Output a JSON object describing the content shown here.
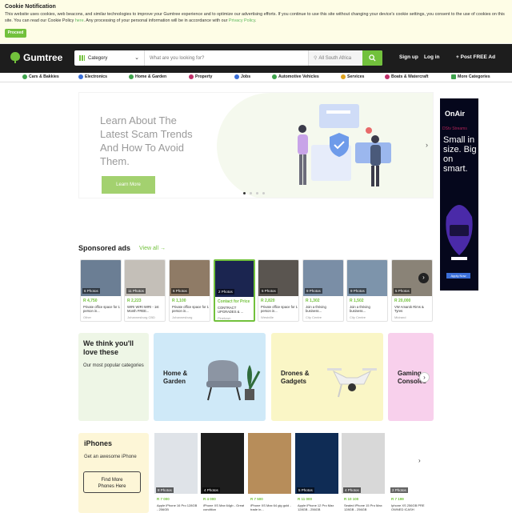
{
  "cookie": {
    "title": "Cookie Notification",
    "text1": "This website uses cookies, web beacons, and similar technologies to improve your Gumtree experience and to optimize our advertising efforts. If you continue to use this site without changing your device's cookie settings, you consent to the use of cookies on this site. You can read our Cookie Policy ",
    "here": "here",
    "text2": ". Any processing of your personal information will be in accordance with our ",
    "privacy": "Privacy Policy",
    "text3": ".",
    "proceed": "Proceed"
  },
  "header": {
    "brand": "Gumtree",
    "category_placeholder": "Category",
    "search_placeholder": "What are you looking for?",
    "location": "All South Africa",
    "signup": "Sign up",
    "login": "Log in",
    "post_ad": "Post FREE Ad"
  },
  "categories": [
    {
      "label": "Cars & Bakkies",
      "color": "#3fa34d"
    },
    {
      "label": "Electronics",
      "color": "#3b6fd8"
    },
    {
      "label": "Home & Garden",
      "color": "#3fa34d"
    },
    {
      "label": "Property",
      "color": "#c0306a"
    },
    {
      "label": "Jobs",
      "color": "#3b6fd8"
    },
    {
      "label": "Automotive Vehicles",
      "color": "#3fa34d"
    },
    {
      "label": "Services",
      "color": "#e0a420"
    },
    {
      "label": "Boats & Watercraft",
      "color": "#c0306a"
    },
    {
      "label": "More Categories",
      "color": "#3fa34d"
    }
  ],
  "hero": {
    "headline": "Learn About The Latest Scam Trends And How To Avoid Them.",
    "cta": "Learn More"
  },
  "side_ad": {
    "brand": "OnAir",
    "tag": "DStv Streams",
    "text": "Small in size. Big on smart.",
    "cta": "Apply Now"
  },
  "sponsored": {
    "title": "Sponsored ads",
    "view_all": "View all",
    "cards": [
      {
        "photos": "6 Photos",
        "price": "R 4,750",
        "title": "Private office space for 1 person in...",
        "location": "Other",
        "img": "#6b7e94"
      },
      {
        "photos": "11 Photos",
        "price": "R 2,223",
        "title": "WIRI WIRI WIRI - 1st Month FREE...",
        "location": "Johannesburg CBD",
        "img": "#c4bfb8"
      },
      {
        "photos": "6 Photos",
        "price": "R 1,100",
        "title": "Private office space for 1 person in...",
        "location": "Johannesburg",
        "img": "#8f7b66"
      },
      {
        "photos": "2 Photos",
        "price": "Contact for Price",
        "title": "CONTRACT UPGRADES & ...",
        "location": "Pinetown",
        "img": "#1b2550"
      },
      {
        "photos": "5 Photos",
        "price": "R 2,820",
        "title": "Private office space for 1 person in...",
        "location": "Westville",
        "img": "#5a5550"
      },
      {
        "photos": "9 Photos",
        "price": "R 1,302",
        "title": "Join a thriving business...",
        "location": "City Centre",
        "img": "#7a8ea6"
      },
      {
        "photos": "9 Photos",
        "price": "R 1,502",
        "title": "Join a thriving business...",
        "location": "City Centre",
        "img": "#7d94ab"
      },
      {
        "photos": "5 Photos",
        "price": "R 20,000",
        "title": "VW Amarok Rims & Tyres",
        "location": "Midrand",
        "img": "#8a8377"
      }
    ]
  },
  "tiles": {
    "intro_title": "We think you'll love these",
    "intro_sub": "Our most popular categories",
    "items": [
      {
        "label": "Home & Garden",
        "bg": "#cfe9f8"
      },
      {
        "label": "Drones & Gadgets",
        "bg": "#faf6c6"
      },
      {
        "label": "Gaming Consoles",
        "bg": "#f8d0ec"
      }
    ]
  },
  "iphones": {
    "title": "iPhones",
    "sub": "Get an awesome iPhone",
    "cta": "Find More Phones Here",
    "products": [
      {
        "photos": "8 Photos",
        "price": "R 7 000",
        "title": "Apple iPhone 16 Pro 128GB - 256GB",
        "img": "#dfe3e8"
      },
      {
        "photos": "4 Photos",
        "price": "R 4 000",
        "title": "iPhone XS Max 64gb - Great condition",
        "img": "#1e1e1e"
      },
      {
        "photos": "",
        "price": "R 7 500",
        "title": "iPhone XS Max 64 gig gold - trade in...",
        "img": "#b78d5a"
      },
      {
        "photos": "5 Photos",
        "price": "R 11 000",
        "title": "Apple iPhone 12 Pro Max 128GB - 256GB",
        "img": "#0f2c55"
      },
      {
        "photos": "4 Photos",
        "price": "R 10 100",
        "title": "Sealed iPhone 15 Pro Max 128GB - 256GB",
        "img": "#d8d8d8"
      },
      {
        "photos": "2 Photos",
        "price": "R 7 199",
        "title": "Iphone XS 256GB PRE OWNED ICASH",
        "img": "#ffffff"
      }
    ]
  }
}
